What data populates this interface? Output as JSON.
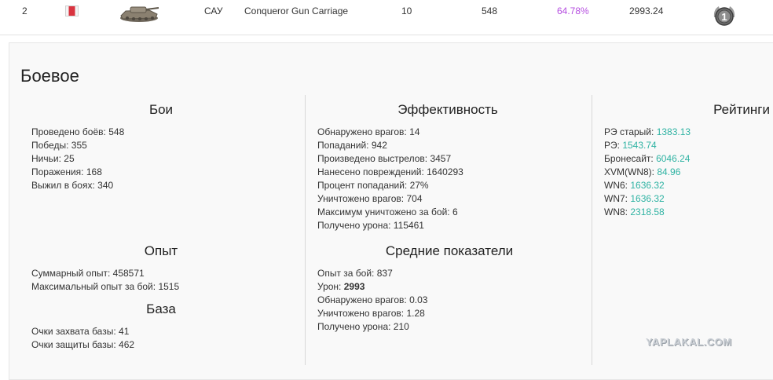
{
  "top_row": {
    "index": "2",
    "type": "САУ",
    "tank_name": "Conqueror Gun Carriage",
    "tier": "10",
    "battles": "548",
    "win_rate": "64.78%",
    "avg_damage": "2993.24",
    "medal_label": "1",
    "colors": {
      "win_rate": "#b54de0"
    }
  },
  "section": {
    "title": "Боевое"
  },
  "battles": {
    "title": "Бои",
    "items": [
      {
        "label": "Проведено боёв:",
        "value": "548"
      },
      {
        "label": "Победы:",
        "value": "355"
      },
      {
        "label": "Ничьи:",
        "value": "25"
      },
      {
        "label": "Поражения:",
        "value": "168"
      },
      {
        "label": "Выжил в боях:",
        "value": "340"
      }
    ]
  },
  "experience": {
    "title": "Опыт",
    "items": [
      {
        "label": "Суммарный опыт:",
        "value": "458571"
      },
      {
        "label": "Максимальный опыт за бой:",
        "value": "1515"
      }
    ]
  },
  "base": {
    "title": "База",
    "items": [
      {
        "label": "Очки захвата базы:",
        "value": "41"
      },
      {
        "label": "Очки защиты базы:",
        "value": "462"
      }
    ]
  },
  "efficiency": {
    "title": "Эффективность",
    "items": [
      {
        "label": "Обнаружено врагов:",
        "value": "14"
      },
      {
        "label": "Попаданий:",
        "value": "942"
      },
      {
        "label": "Произведено выстрелов:",
        "value": "3457"
      },
      {
        "label": "Нанесено повреждений:",
        "value": "1640293"
      },
      {
        "label": "Процент попаданий:",
        "value": "27%"
      },
      {
        "label": "Уничтожено врагов:",
        "value": "704"
      },
      {
        "label": "Максимум уничтожено за бой:",
        "value": "6"
      },
      {
        "label": "Получено урона:",
        "value": "115461"
      }
    ]
  },
  "averages": {
    "title": "Средние показатели",
    "items": [
      {
        "label": "Опыт за бой:",
        "value": "837"
      },
      {
        "label": "Урон:",
        "value": "2993"
      },
      {
        "label": "Обнаружено врагов:",
        "value": "0.03"
      },
      {
        "label": "Уничтожено врагов:",
        "value": "1.28"
      },
      {
        "label": "Получено урона:",
        "value": "210"
      }
    ]
  },
  "ratings": {
    "title": "Рейтинги",
    "items": [
      {
        "label": "РЭ старый:",
        "value": "1383.13"
      },
      {
        "label": "РЭ:",
        "value": "1543.74"
      },
      {
        "label": "Бронесайт:",
        "value": "6046.24"
      },
      {
        "label": "XVM(WN8):",
        "value": "84.96"
      },
      {
        "label": "WN6:",
        "value": "1636.32"
      },
      {
        "label": "WN7:",
        "value": "1636.32"
      },
      {
        "label": "WN8:",
        "value": "2318.58"
      }
    ],
    "colors": {
      "value": "#2fb3a3"
    }
  },
  "watermark": "YAPLAKAL.COM"
}
